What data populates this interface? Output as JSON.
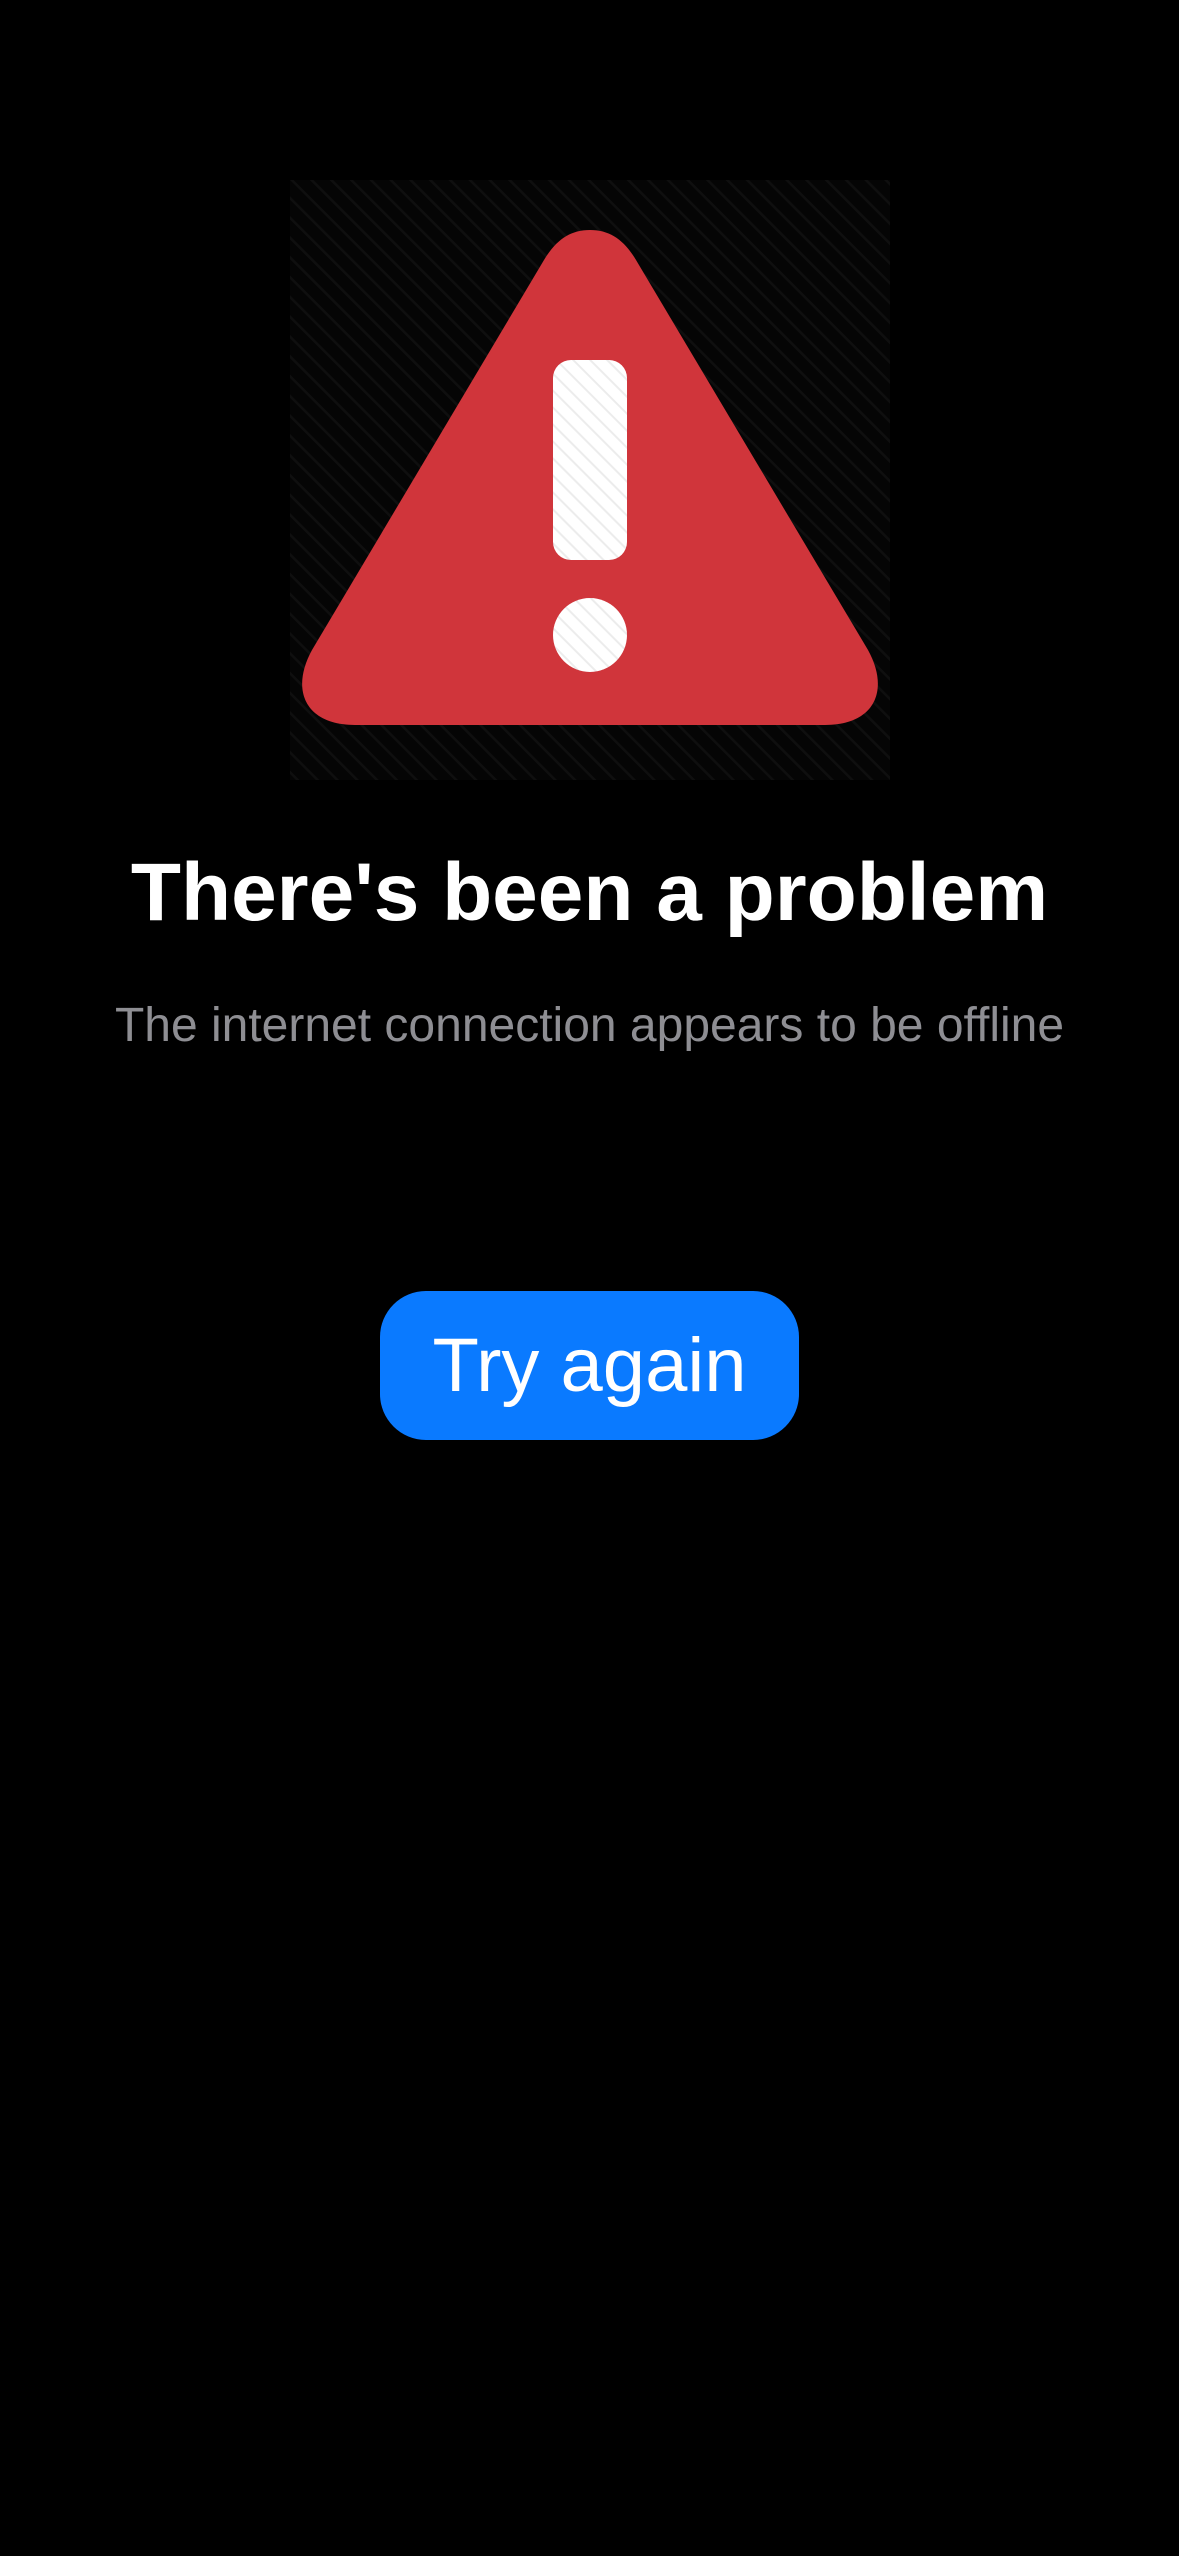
{
  "error_screen": {
    "icon": "warning-triangle-icon",
    "title": "There's been a problem",
    "message": "The internet connection appears to be offline",
    "retry_label": "Try again"
  },
  "colors": {
    "background": "#000000",
    "warning_red": "#d0353b",
    "accent_blue": "#0a7aff",
    "title_text": "#ffffff",
    "message_text": "#8e8e93"
  }
}
